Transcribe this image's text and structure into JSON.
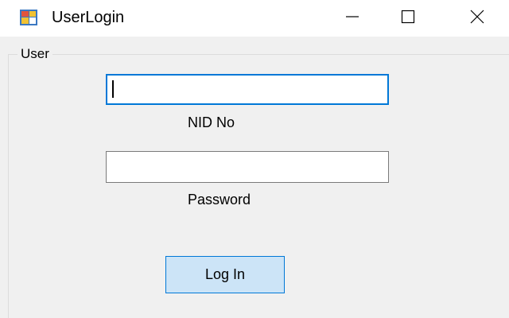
{
  "window": {
    "title": "UserLogin",
    "app_icon": "windows-form-icon",
    "controls": {
      "minimize_icon": "minimize-icon",
      "maximize_icon": "maximize-icon",
      "close_icon": "close-icon"
    }
  },
  "form": {
    "group_label": "User",
    "nid_field": {
      "value": "",
      "label": "NID No"
    },
    "password_field": {
      "value": "",
      "label": "Password"
    },
    "login_button_label": "Log In"
  },
  "colors": {
    "focus_border": "#0078d7",
    "button_background": "#cce4f7",
    "button_border": "#0078d7",
    "form_background": "#f0f0f0",
    "titlebar_background": "#ffffff"
  }
}
